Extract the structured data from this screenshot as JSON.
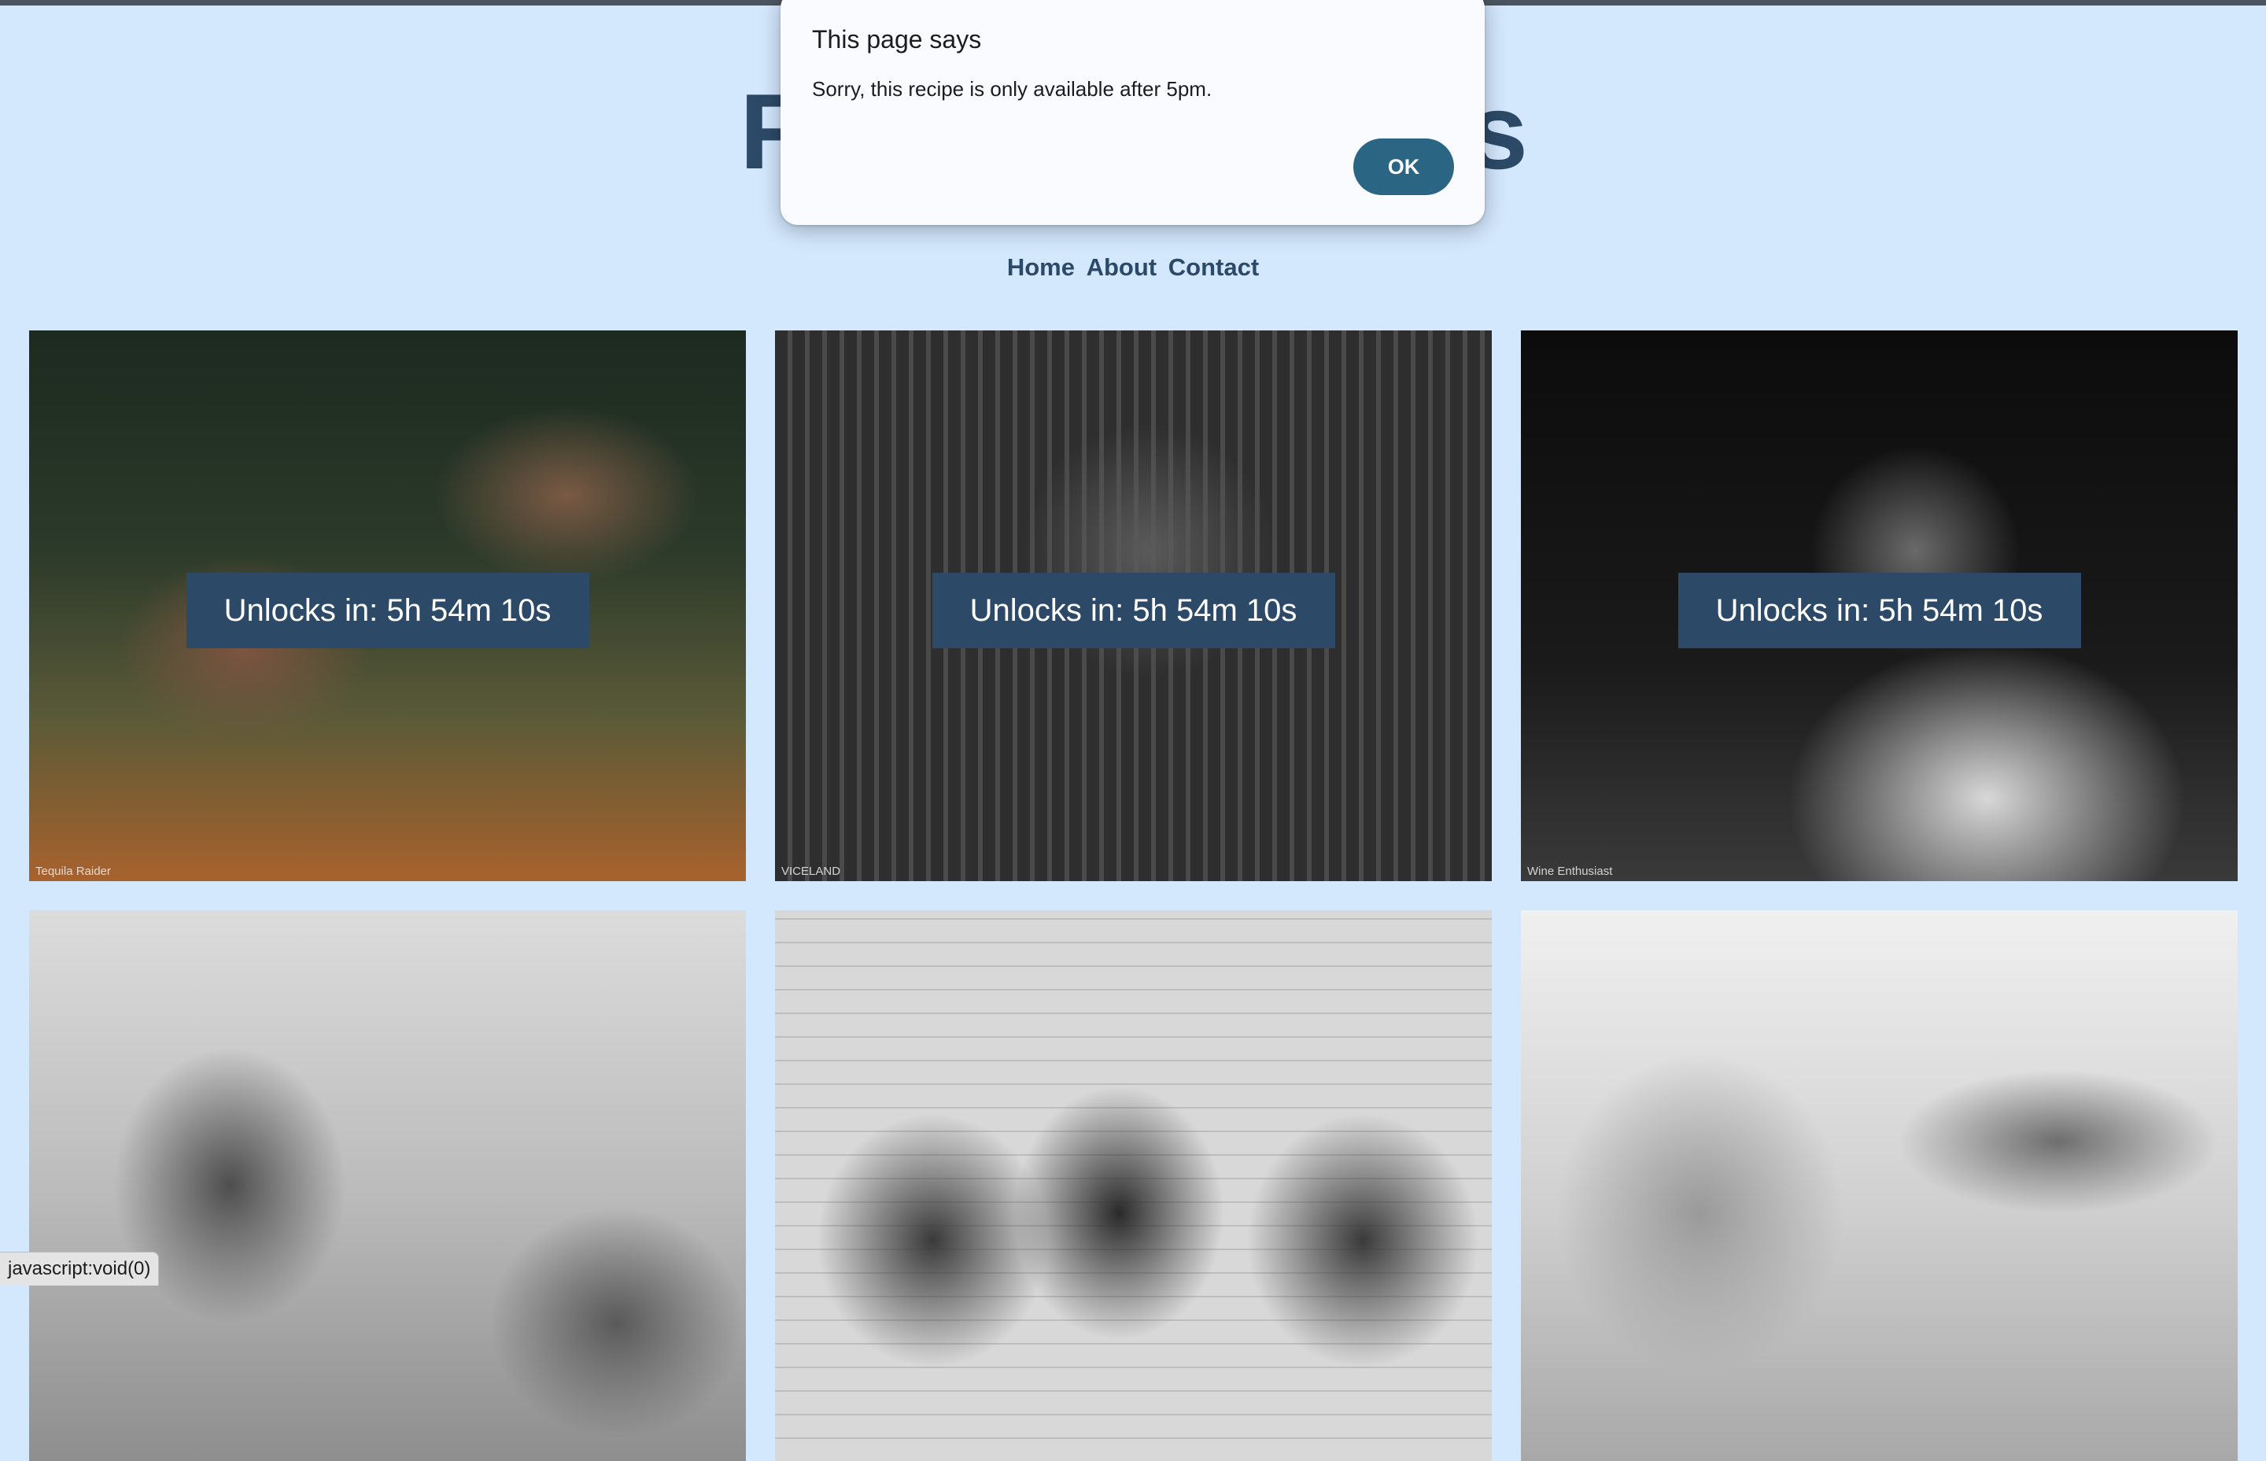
{
  "site": {
    "title": "Rapper Recipes",
    "nav": [
      "Home",
      "About",
      "Contact"
    ]
  },
  "cards": [
    {
      "unlock_text": "Unlocks in: 5h 54m 10s",
      "credit": "Tequila Raider"
    },
    {
      "unlock_text": "Unlocks in: 5h 54m 10s",
      "credit": "VICELAND"
    },
    {
      "unlock_text": "Unlocks in: 5h 54m 10s",
      "credit": "Wine Enthusiast"
    },
    {
      "unlock_text": "",
      "credit": ""
    },
    {
      "unlock_text": "",
      "credit": ""
    },
    {
      "unlock_text": "",
      "credit": ""
    }
  ],
  "dialog": {
    "title": "This page says",
    "message": "Sorry, this recipe is only available after 5pm.",
    "ok_label": "OK"
  },
  "status_bar": {
    "text": "javascript:void(0)"
  },
  "colors": {
    "background": "#d3e7fd",
    "accent": "#2c4a68",
    "ok_button": "#2a6584"
  }
}
